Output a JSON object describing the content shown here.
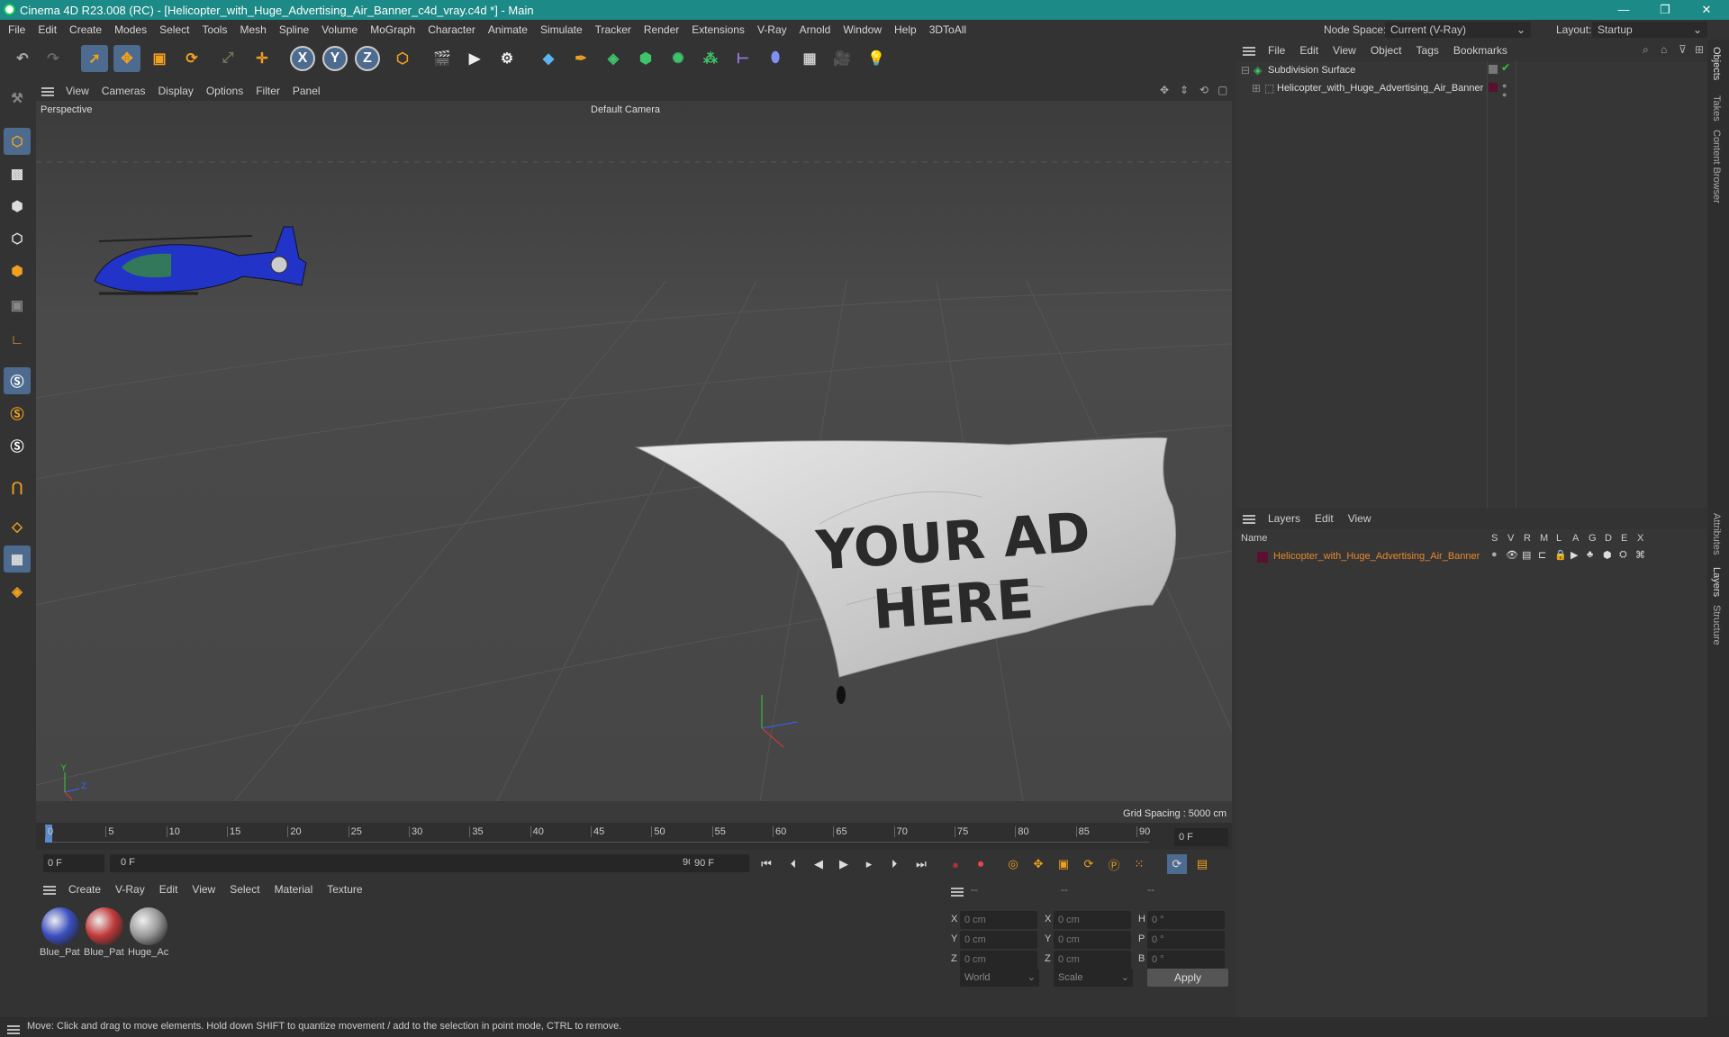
{
  "window": {
    "title": "Cinema 4D R23.008 (RC) - [Helicopter_with_Huge_Advertising_Air_Banner_c4d_vray.c4d *] - Main",
    "minimize": "—",
    "maximize": "❐",
    "close": "✕"
  },
  "menubar": {
    "items": [
      "File",
      "Edit",
      "Create",
      "Modes",
      "Select",
      "Tools",
      "Mesh",
      "Spline",
      "Volume",
      "MoGraph",
      "Character",
      "Animate",
      "Simulate",
      "Tracker",
      "Render",
      "Extensions",
      "V-Ray",
      "Arnold",
      "Window",
      "Help",
      "3DToAll"
    ],
    "node_space_label": "Node Space:",
    "node_space_value": "Current (V-Ray)",
    "layout_label": "Layout:",
    "layout_value": "Startup"
  },
  "viewport": {
    "menu": [
      "View",
      "Cameras",
      "Display",
      "Options",
      "Filter",
      "Panel"
    ],
    "label": "Perspective",
    "camera": "Default Camera",
    "grid_spacing": "Grid Spacing : 5000 cm",
    "banner_text_line1": "YOUR AD",
    "banner_text_line2": "HERE",
    "axis_labels": {
      "y": "Y",
      "z": "Z",
      "x": "X"
    }
  },
  "timeline": {
    "ticks": [
      "0",
      "5",
      "10",
      "15",
      "20",
      "25",
      "30",
      "35",
      "40",
      "45",
      "50",
      "55",
      "60",
      "65",
      "70",
      "75",
      "80",
      "85",
      "90"
    ],
    "current_frame": "0 F"
  },
  "transport": {
    "start_frame": "0 F",
    "range_start": "0 F",
    "range_end": "90 F",
    "end_frame": "90 F"
  },
  "materials": {
    "menu": [
      "Create",
      "V-Ray",
      "Edit",
      "View",
      "Select",
      "Material",
      "Texture"
    ],
    "items": [
      {
        "name": "Blue_Pat",
        "color": "#3a4fc0"
      },
      {
        "name": "Blue_Pat",
        "color": "#c03a3a"
      },
      {
        "name": "Huge_Ac",
        "color": "#999999"
      }
    ]
  },
  "coordinates": {
    "headers": [
      "--",
      "--",
      "--"
    ],
    "rows": [
      {
        "a": "X",
        "av": "0 cm",
        "b": "X",
        "bv": "0 cm",
        "c": "H",
        "cv": "0 °"
      },
      {
        "a": "Y",
        "av": "0 cm",
        "b": "Y",
        "bv": "0 cm",
        "c": "P",
        "cv": "0 °"
      },
      {
        "a": "Z",
        "av": "0 cm",
        "b": "Z",
        "bv": "0 cm",
        "c": "B",
        "cv": "0 °"
      }
    ],
    "world": "World",
    "scale": "Scale",
    "apply": "Apply"
  },
  "objects": {
    "menu": [
      "File",
      "Edit",
      "View",
      "Object",
      "Tags",
      "Bookmarks"
    ],
    "tree": [
      {
        "name": "Subdivision Surface"
      },
      {
        "name": "Helicopter_with_Huge_Advertising_Air_Banner"
      }
    ]
  },
  "layers": {
    "menu": [
      "Layers",
      "Edit",
      "View"
    ],
    "columns": [
      "Name",
      "S",
      "V",
      "R",
      "M",
      "L",
      "A",
      "G",
      "D",
      "E",
      "X"
    ],
    "rows": [
      {
        "name": "Helicopter_with_Huge_Advertising_Air_Banner",
        "color": "#5a1030"
      }
    ]
  },
  "right_tabs": [
    "Objects",
    "Takes",
    "Content Browser",
    "Attributes",
    "Layers",
    "Structure"
  ],
  "status": "Move: Click and drag to move elements. Hold down SHIFT to quantize movement / add to the selection in point mode, CTRL to remove.",
  "colors": {
    "accent": "#1c8a86",
    "highlight": "#e8882a",
    "selected_blue": "#4c6b8f"
  }
}
